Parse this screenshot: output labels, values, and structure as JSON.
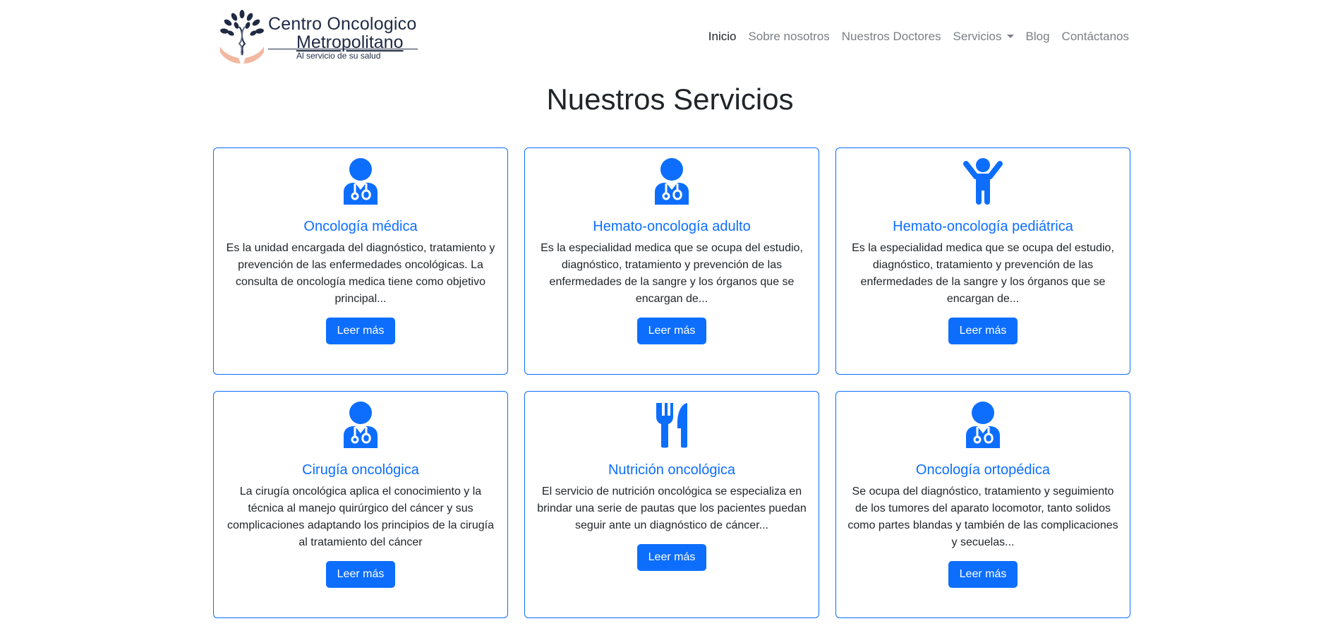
{
  "brand": {
    "name_line1": "Centro Oncologico",
    "name_line2": "Metropolitano",
    "tagline": "Al servicio de su salud"
  },
  "nav": {
    "items": [
      {
        "label": "Inicio",
        "active": true
      },
      {
        "label": "Sobre nosotros"
      },
      {
        "label": "Nuestros Doctores"
      },
      {
        "label": "Servicios",
        "dropdown": true
      },
      {
        "label": "Blog"
      },
      {
        "label": "Contáctanos"
      }
    ]
  },
  "main": {
    "title": "Nuestros Servicios",
    "button_label": "Leer más",
    "cards": [
      {
        "icon": "doctor-icon",
        "title": "Oncología médica",
        "text": "Es la unidad encargada del diagnóstico, tratamiento y prevención de las enfermedades oncológicas. La consulta de oncología medica tiene como objetivo principal..."
      },
      {
        "icon": "doctor-icon",
        "title": "Hemato-oncología adulto",
        "text": "Es la especialidad medica que se ocupa del estudio, diagnóstico, tratamiento y prevención de las enfermedades de la sangre y los órganos que se encargan de..."
      },
      {
        "icon": "child-icon",
        "title": "Hemato-oncología pediátrica",
        "text": "Es la especialidad medica que se ocupa del estudio, diagnóstico, tratamiento y prevención de las enfermedades de la sangre y los órganos que se encargan de..."
      },
      {
        "icon": "doctor-icon",
        "title": "Cirugía oncológica",
        "text": "La cirugía oncológica aplica el conocimiento y la técnica al manejo quirúrgico del cáncer y sus complicaciones adaptando los principios de la cirugía al tratamiento del cáncer"
      },
      {
        "icon": "utensils-icon",
        "title": "Nutrición oncológica",
        "text": "El servicio de nutrición oncológica se especializa en brindar una serie de pautas que los pacientes puedan seguir ante un diagnóstico de cáncer..."
      },
      {
        "icon": "doctor-icon",
        "title": "Oncología ortopédica",
        "text": "Se ocupa del diagnóstico, tratamiento y seguimiento de los tumores del aparato locomotor, tanto solidos como partes blandas y también de las complicaciones y secuelas..."
      }
    ]
  },
  "colors": {
    "primary": "#0d6efd",
    "text": "#212529",
    "nav_muted": "#7a7f85",
    "brand_dark": "#1f2a44",
    "hands": "#f2b8a0"
  }
}
